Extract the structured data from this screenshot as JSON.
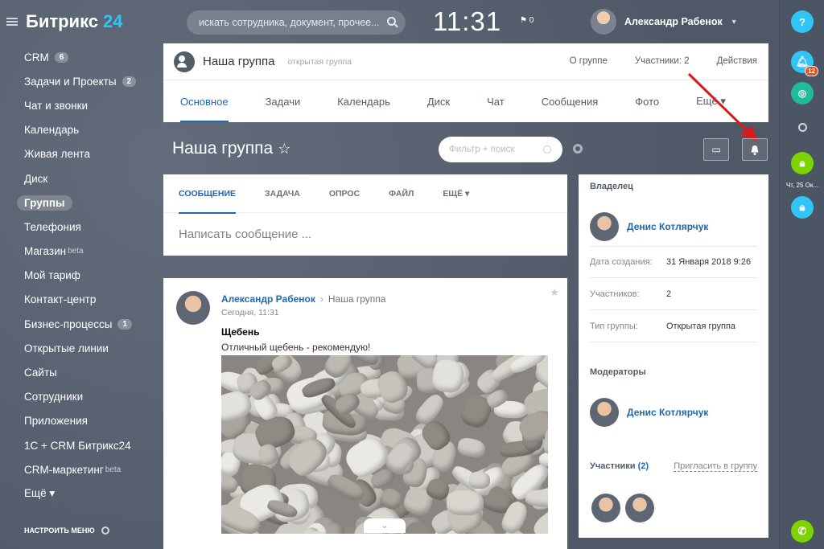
{
  "brand": {
    "name": "Битрикс",
    "num": "24"
  },
  "sidebar": {
    "items": [
      {
        "label": "CRM",
        "badge": "6"
      },
      {
        "label": "Задачи и Проекты",
        "badge": "2"
      },
      {
        "label": "Чат и звонки"
      },
      {
        "label": "Календарь"
      },
      {
        "label": "Живая лента"
      },
      {
        "label": "Диск"
      },
      {
        "label": "Группы",
        "active": true
      },
      {
        "label": "Телефония"
      },
      {
        "label": "Магазин",
        "beta": "beta"
      },
      {
        "label": "Мой тариф"
      },
      {
        "label": "Контакт-центр"
      },
      {
        "label": "Бизнес-процессы",
        "badge": "1"
      },
      {
        "label": "Открытые линии"
      },
      {
        "label": "Сайты"
      },
      {
        "label": "Сотрудники"
      },
      {
        "label": "Приложения"
      },
      {
        "label": "1С + CRM Битрикс24"
      },
      {
        "label": "CRM-маркетинг",
        "beta": "beta"
      },
      {
        "label": "Ещё ▾"
      }
    ],
    "configure": "НАСТРОИТЬ МЕНЮ"
  },
  "header": {
    "search_placeholder": "искать сотрудника, документ, прочее...",
    "time": "11:31",
    "flag_count": "0",
    "user": "Александр Рабенок"
  },
  "group": {
    "name": "Наша группа",
    "type": "открытая группа",
    "links": [
      "О группе",
      "Участники: 2",
      "Действия"
    ],
    "tabs": [
      "Основное",
      "Задачи",
      "Календарь",
      "Диск",
      "Чат",
      "Сообщения",
      "Фото",
      "Ещё ▾"
    ]
  },
  "title": {
    "text": "Наша группа",
    "star": "☆",
    "filter_placeholder": "Фильтр + поиск"
  },
  "composer": {
    "tabs": [
      "СООБЩЕНИЕ",
      "ЗАДАЧА",
      "ОПРОС",
      "ФАЙЛ",
      "ЕЩЁ ▾"
    ],
    "placeholder": "Написать сообщение ..."
  },
  "post": {
    "author": "Александр Рабенок",
    "arrow": "›",
    "group": "Наша группа",
    "date": "Сегодня, 11:31",
    "title": "Щебень",
    "text": "Отличный щебень - рекомендую!"
  },
  "panel": {
    "owner_h": "Владелец",
    "owner": "Денис Котлярчук",
    "rows": [
      {
        "k": "Дата создания:",
        "v": "31 Января 2018 9:26"
      },
      {
        "k": "Участников:",
        "v": "2"
      },
      {
        "k": "Тип группы:",
        "v": "Открытая группа"
      }
    ],
    "mods_h": "Модераторы",
    "moderator": "Денис Котлярчук",
    "members_h": "Участники",
    "members_count": "(2)",
    "invite": "Пригласить в группу"
  },
  "rightbar": {
    "help": "?",
    "notif_count": "12",
    "date": "Чт, 25 Ок..."
  },
  "colors": {
    "accent": "#2067b0",
    "green": "#7bd500",
    "teal": "#1fbc9c",
    "help": "#2fc6f6",
    "alert": "#f54819"
  }
}
